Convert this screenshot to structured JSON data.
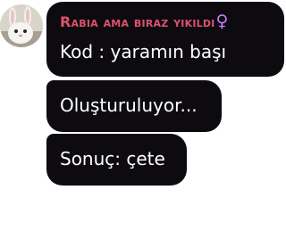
{
  "chat": {
    "author": {
      "name": "Rabia ama biraz yıkıldı",
      "icon": "female-sign-icon",
      "icon_glyph": "♀",
      "name_color": "#e0516e",
      "icon_color": "#c77dff"
    },
    "messages": [
      {
        "text": "Kod : yaramın başı"
      },
      {
        "text": "Oluşturuluyor..."
      },
      {
        "text": "Sonuç: çete"
      }
    ],
    "bubble_color": "#0d0b10"
  }
}
